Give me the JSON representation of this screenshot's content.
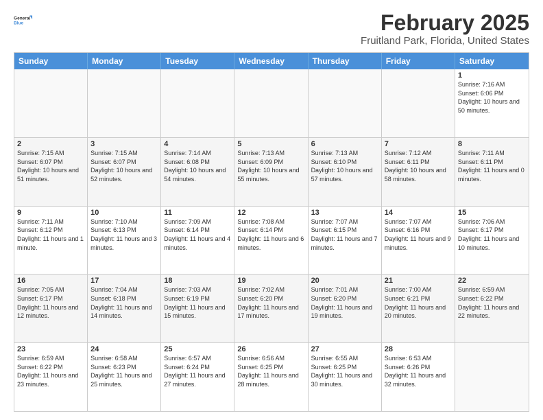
{
  "header": {
    "logo_line1": "General",
    "logo_line2": "Blue",
    "month": "February 2025",
    "location": "Fruitland Park, Florida, United States"
  },
  "weekdays": [
    "Sunday",
    "Monday",
    "Tuesday",
    "Wednesday",
    "Thursday",
    "Friday",
    "Saturday"
  ],
  "rows": [
    [
      {
        "day": "",
        "info": ""
      },
      {
        "day": "",
        "info": ""
      },
      {
        "day": "",
        "info": ""
      },
      {
        "day": "",
        "info": ""
      },
      {
        "day": "",
        "info": ""
      },
      {
        "day": "",
        "info": ""
      },
      {
        "day": "1",
        "info": "Sunrise: 7:16 AM\nSunset: 6:06 PM\nDaylight: 10 hours and 50 minutes."
      }
    ],
    [
      {
        "day": "2",
        "info": "Sunrise: 7:15 AM\nSunset: 6:07 PM\nDaylight: 10 hours and 51 minutes."
      },
      {
        "day": "3",
        "info": "Sunrise: 7:15 AM\nSunset: 6:07 PM\nDaylight: 10 hours and 52 minutes."
      },
      {
        "day": "4",
        "info": "Sunrise: 7:14 AM\nSunset: 6:08 PM\nDaylight: 10 hours and 54 minutes."
      },
      {
        "day": "5",
        "info": "Sunrise: 7:13 AM\nSunset: 6:09 PM\nDaylight: 10 hours and 55 minutes."
      },
      {
        "day": "6",
        "info": "Sunrise: 7:13 AM\nSunset: 6:10 PM\nDaylight: 10 hours and 57 minutes."
      },
      {
        "day": "7",
        "info": "Sunrise: 7:12 AM\nSunset: 6:11 PM\nDaylight: 10 hours and 58 minutes."
      },
      {
        "day": "8",
        "info": "Sunrise: 7:11 AM\nSunset: 6:11 PM\nDaylight: 11 hours and 0 minutes."
      }
    ],
    [
      {
        "day": "9",
        "info": "Sunrise: 7:11 AM\nSunset: 6:12 PM\nDaylight: 11 hours and 1 minute."
      },
      {
        "day": "10",
        "info": "Sunrise: 7:10 AM\nSunset: 6:13 PM\nDaylight: 11 hours and 3 minutes."
      },
      {
        "day": "11",
        "info": "Sunrise: 7:09 AM\nSunset: 6:14 PM\nDaylight: 11 hours and 4 minutes."
      },
      {
        "day": "12",
        "info": "Sunrise: 7:08 AM\nSunset: 6:14 PM\nDaylight: 11 hours and 6 minutes."
      },
      {
        "day": "13",
        "info": "Sunrise: 7:07 AM\nSunset: 6:15 PM\nDaylight: 11 hours and 7 minutes."
      },
      {
        "day": "14",
        "info": "Sunrise: 7:07 AM\nSunset: 6:16 PM\nDaylight: 11 hours and 9 minutes."
      },
      {
        "day": "15",
        "info": "Sunrise: 7:06 AM\nSunset: 6:17 PM\nDaylight: 11 hours and 10 minutes."
      }
    ],
    [
      {
        "day": "16",
        "info": "Sunrise: 7:05 AM\nSunset: 6:17 PM\nDaylight: 11 hours and 12 minutes."
      },
      {
        "day": "17",
        "info": "Sunrise: 7:04 AM\nSunset: 6:18 PM\nDaylight: 11 hours and 14 minutes."
      },
      {
        "day": "18",
        "info": "Sunrise: 7:03 AM\nSunset: 6:19 PM\nDaylight: 11 hours and 15 minutes."
      },
      {
        "day": "19",
        "info": "Sunrise: 7:02 AM\nSunset: 6:20 PM\nDaylight: 11 hours and 17 minutes."
      },
      {
        "day": "20",
        "info": "Sunrise: 7:01 AM\nSunset: 6:20 PM\nDaylight: 11 hours and 19 minutes."
      },
      {
        "day": "21",
        "info": "Sunrise: 7:00 AM\nSunset: 6:21 PM\nDaylight: 11 hours and 20 minutes."
      },
      {
        "day": "22",
        "info": "Sunrise: 6:59 AM\nSunset: 6:22 PM\nDaylight: 11 hours and 22 minutes."
      }
    ],
    [
      {
        "day": "23",
        "info": "Sunrise: 6:59 AM\nSunset: 6:22 PM\nDaylight: 11 hours and 23 minutes."
      },
      {
        "day": "24",
        "info": "Sunrise: 6:58 AM\nSunset: 6:23 PM\nDaylight: 11 hours and 25 minutes."
      },
      {
        "day": "25",
        "info": "Sunrise: 6:57 AM\nSunset: 6:24 PM\nDaylight: 11 hours and 27 minutes."
      },
      {
        "day": "26",
        "info": "Sunrise: 6:56 AM\nSunset: 6:25 PM\nDaylight: 11 hours and 28 minutes."
      },
      {
        "day": "27",
        "info": "Sunrise: 6:55 AM\nSunset: 6:25 PM\nDaylight: 11 hours and 30 minutes."
      },
      {
        "day": "28",
        "info": "Sunrise: 6:53 AM\nSunset: 6:26 PM\nDaylight: 11 hours and 32 minutes."
      },
      {
        "day": "",
        "info": ""
      }
    ]
  ]
}
